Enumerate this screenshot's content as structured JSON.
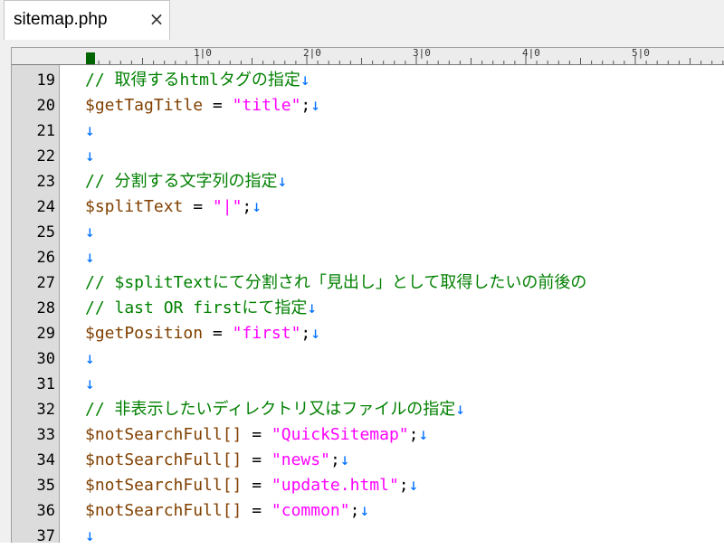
{
  "tab": {
    "title": "sitemap.php",
    "close_glyph": "×"
  },
  "ruler": {
    "labels": [
      "1|0",
      "2|0",
      "3|0",
      "4|0",
      "5|0"
    ]
  },
  "colors": {
    "comment": "#008000",
    "variable": "#804000",
    "string": "#ff00ff",
    "newline_marker": "#0070ff",
    "gutter_bg": "#dcdcdc",
    "cursor_marker": "#006400"
  },
  "lines": [
    {
      "num": "19",
      "tokens": [
        {
          "t": "comment",
          "v": "// 取得するhtmlタグの指定"
        },
        {
          "t": "nl",
          "v": "↓"
        }
      ]
    },
    {
      "num": "20",
      "tokens": [
        {
          "t": "var",
          "v": "$getTagTitle"
        },
        {
          "t": "op",
          "v": " = "
        },
        {
          "t": "str",
          "v": "\"title\""
        },
        {
          "t": "op",
          "v": ";"
        },
        {
          "t": "nl",
          "v": "↓"
        }
      ]
    },
    {
      "num": "21",
      "tokens": [
        {
          "t": "nl",
          "v": "↓"
        }
      ]
    },
    {
      "num": "22",
      "tokens": [
        {
          "t": "nl",
          "v": "↓"
        }
      ]
    },
    {
      "num": "23",
      "tokens": [
        {
          "t": "comment",
          "v": "// 分割する文字列の指定"
        },
        {
          "t": "nl",
          "v": "↓"
        }
      ]
    },
    {
      "num": "24",
      "tokens": [
        {
          "t": "var",
          "v": "$splitText"
        },
        {
          "t": "op",
          "v": " = "
        },
        {
          "t": "str",
          "v": "\"|\""
        },
        {
          "t": "op",
          "v": ";"
        },
        {
          "t": "nl",
          "v": "↓"
        }
      ]
    },
    {
      "num": "25",
      "tokens": [
        {
          "t": "nl",
          "v": "↓"
        }
      ]
    },
    {
      "num": "26",
      "tokens": [
        {
          "t": "nl",
          "v": "↓"
        }
      ]
    },
    {
      "num": "27",
      "tokens": [
        {
          "t": "comment",
          "v": "// $splitTextにて分割され「見出し」として取得したいの前後の"
        }
      ]
    },
    {
      "num": "28",
      "tokens": [
        {
          "t": "comment",
          "v": "// last OR firstにて指定"
        },
        {
          "t": "nl",
          "v": "↓"
        }
      ]
    },
    {
      "num": "29",
      "tokens": [
        {
          "t": "var",
          "v": "$getPosition"
        },
        {
          "t": "op",
          "v": " = "
        },
        {
          "t": "str",
          "v": "\"first\""
        },
        {
          "t": "op",
          "v": ";"
        },
        {
          "t": "nl",
          "v": "↓"
        }
      ]
    },
    {
      "num": "30",
      "tokens": [
        {
          "t": "nl",
          "v": "↓"
        }
      ]
    },
    {
      "num": "31",
      "tokens": [
        {
          "t": "nl",
          "v": "↓"
        }
      ]
    },
    {
      "num": "32",
      "tokens": [
        {
          "t": "comment",
          "v": "// 非表示したいディレクトリ又はファイルの指定"
        },
        {
          "t": "nl",
          "v": "↓"
        }
      ]
    },
    {
      "num": "33",
      "tokens": [
        {
          "t": "var",
          "v": "$notSearchFull[]"
        },
        {
          "t": "op",
          "v": " = "
        },
        {
          "t": "str",
          "v": "\"QuickSitemap\""
        },
        {
          "t": "op",
          "v": ";"
        },
        {
          "t": "nl",
          "v": "↓"
        }
      ]
    },
    {
      "num": "34",
      "tokens": [
        {
          "t": "var",
          "v": "$notSearchFull[]"
        },
        {
          "t": "op",
          "v": " = "
        },
        {
          "t": "str",
          "v": "\"news\""
        },
        {
          "t": "op",
          "v": ";"
        },
        {
          "t": "nl",
          "v": "↓"
        }
      ]
    },
    {
      "num": "35",
      "tokens": [
        {
          "t": "var",
          "v": "$notSearchFull[]"
        },
        {
          "t": "op",
          "v": " = "
        },
        {
          "t": "str",
          "v": "\"update.html\""
        },
        {
          "t": "op",
          "v": ";"
        },
        {
          "t": "nl",
          "v": "↓"
        }
      ]
    },
    {
      "num": "36",
      "tokens": [
        {
          "t": "var",
          "v": "$notSearchFull[]"
        },
        {
          "t": "op",
          "v": " = "
        },
        {
          "t": "str",
          "v": "\"common\""
        },
        {
          "t": "op",
          "v": ";"
        },
        {
          "t": "nl",
          "v": "↓"
        }
      ]
    },
    {
      "num": "37",
      "tokens": [
        {
          "t": "nl",
          "v": "↓"
        }
      ]
    }
  ]
}
